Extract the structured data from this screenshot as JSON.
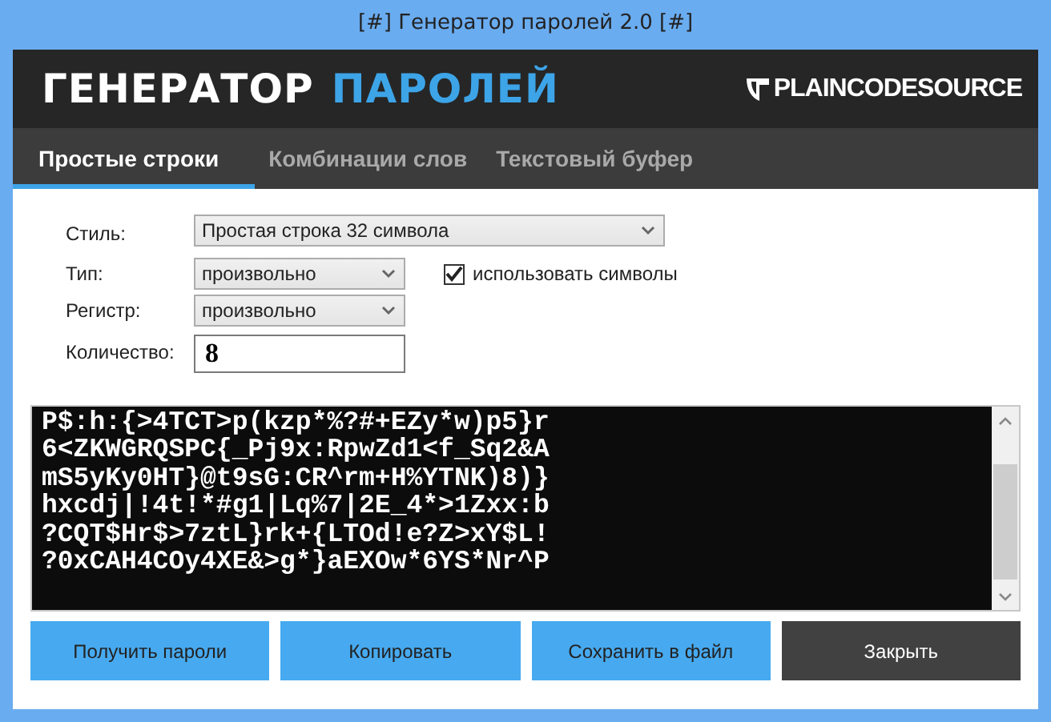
{
  "window": {
    "title": "[#] Генератор паролей 2.0 [#]"
  },
  "header": {
    "title_main": "ГЕНЕРАТОР",
    "title_accent": "ПАРОЛЕЙ",
    "brand": "PLAINCODESOURCE"
  },
  "tabs": [
    {
      "label": "Простые строки",
      "selected": true
    },
    {
      "label": "Комбинации слов",
      "selected": false
    },
    {
      "label": "Текстовый буфер",
      "selected": false
    }
  ],
  "form": {
    "style": {
      "label": "Стиль:",
      "value": "Простая строка 32 символа"
    },
    "type": {
      "label": "Тип:",
      "value": "произвольно"
    },
    "use_symbols": {
      "label": "использовать символы",
      "checked": true
    },
    "case": {
      "label": "Регистр:",
      "value": "произвольно"
    },
    "count": {
      "label": "Количество:",
      "value": "8"
    }
  },
  "output": {
    "lines": [
      "P$:h:{>4TCT>p(kzp*%?#+EZy*w)p5}r",
      "6<ZKWGRQSPC{_Pj9x:RpwZd1<f_Sq2&A",
      "mS5yKy0HT}@t9sG:CR^rm+H%YTNK)8)}",
      "hxcdj|!4t!*#g1|Lq%7|2E_4*>1Zxx:b",
      "?CQT$Hr$>7ztL}rk+{LTOd!e?Z>xY$L!",
      "?0xCAH4COy4XE&>g*}aEXOw*6YS*Nr^P"
    ]
  },
  "buttons": [
    {
      "label": "Получить пароли",
      "kind": "primary"
    },
    {
      "label": "Копировать",
      "kind": "primary"
    },
    {
      "label": "Сохранить в файл",
      "kind": "primary"
    },
    {
      "label": "Закрыть",
      "kind": "dark"
    }
  ]
}
